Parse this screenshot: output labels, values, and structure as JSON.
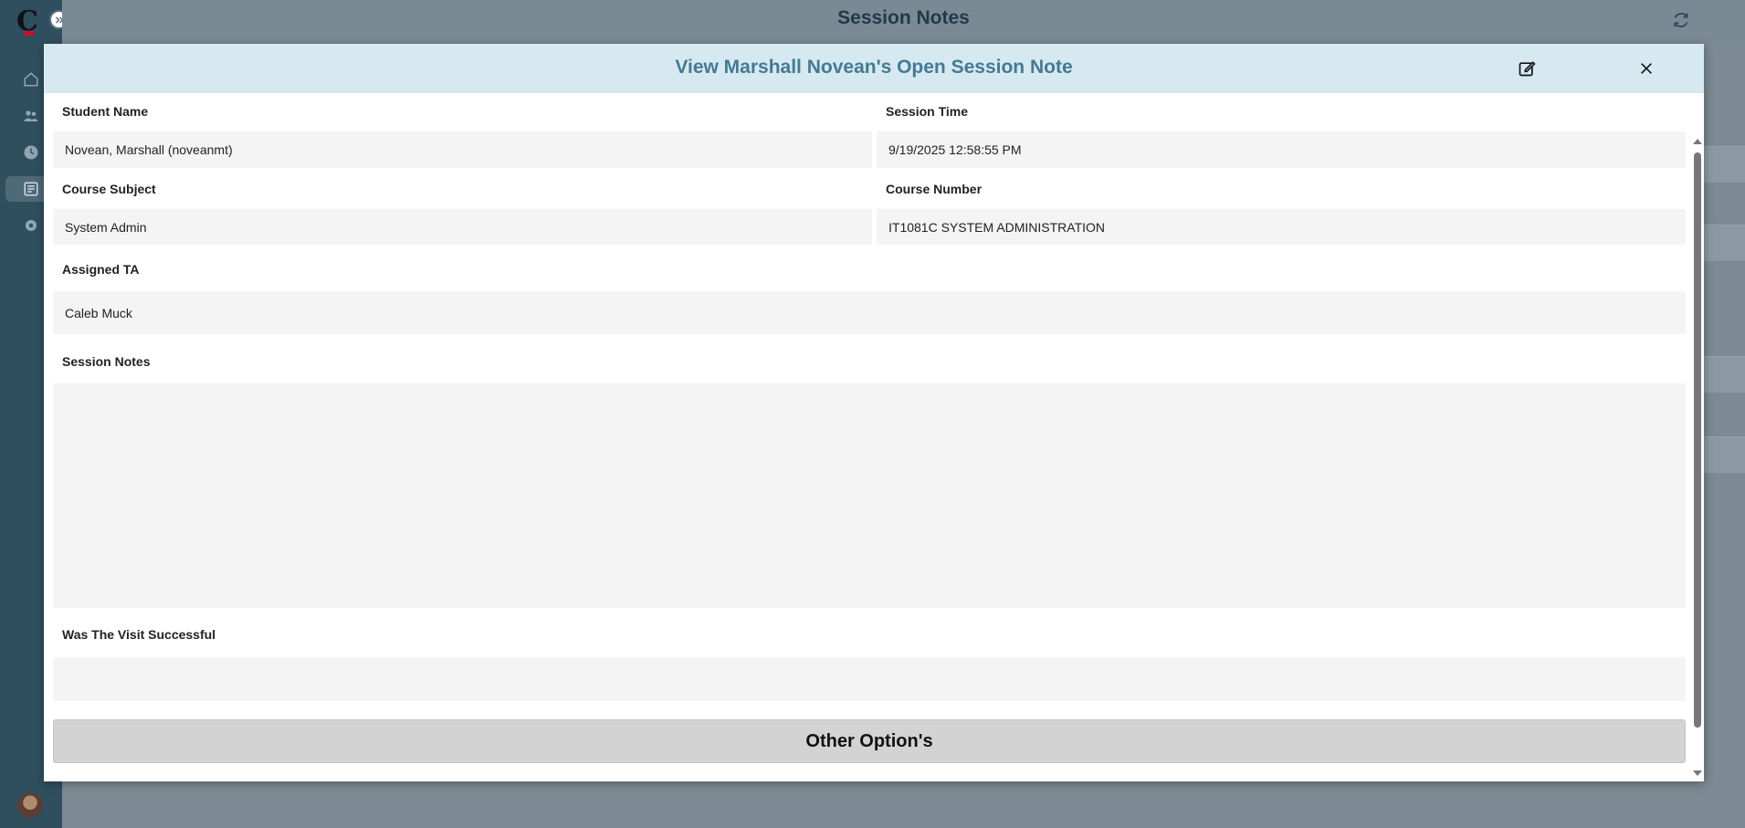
{
  "app": {
    "page_title": "Session Notes",
    "nav_icons": [
      "home-icon",
      "users-icon",
      "clock-icon",
      "notes-icon",
      "gear-icon"
    ],
    "active_nav": "notes-icon"
  },
  "modal": {
    "title": "View Marshall Novean's Open Session Note",
    "fields": {
      "student_name": {
        "label": "Student Name",
        "value": "Novean, Marshall (noveanmt)"
      },
      "session_time": {
        "label": "Session Time",
        "value": "9/19/2025 12:58:55 PM"
      },
      "course_subject": {
        "label": "Course Subject",
        "value": "System Admin"
      },
      "course_number": {
        "label": "Course Number",
        "value": "IT1081C SYSTEM ADMINISTRATION"
      },
      "assigned_ta": {
        "label": "Assigned TA",
        "value": "Caleb Muck"
      },
      "session_notes": {
        "label": "Session Notes",
        "value": ""
      },
      "visit_successful": {
        "label": "Was The Visit Successful",
        "value": ""
      }
    },
    "other_options_label": "Other Option's"
  },
  "colors": {
    "modal_header_bg": "#d6e9f1",
    "modal_title": "#437a93",
    "sidebar": "#2f4f5f"
  }
}
